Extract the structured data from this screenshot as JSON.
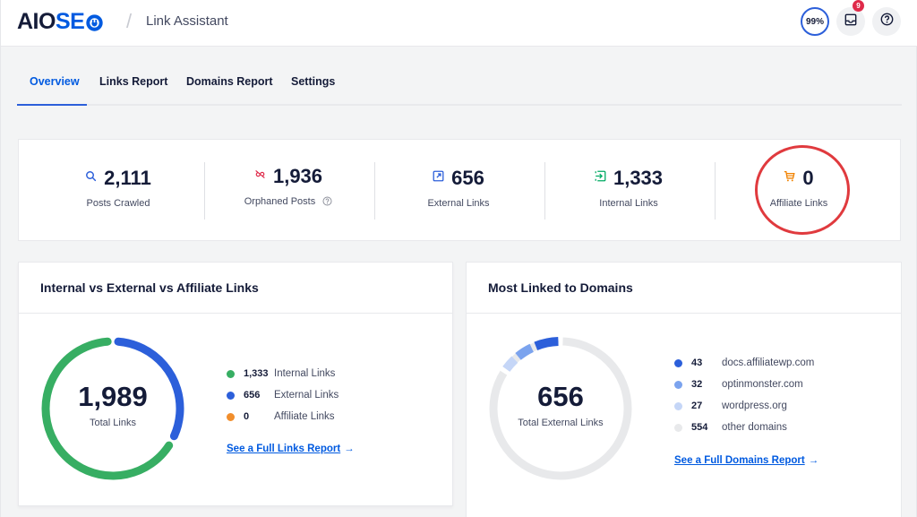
{
  "header": {
    "logo_part1": "AIO",
    "logo_part2": "SE",
    "page_title": "Link Assistant",
    "score": "99%",
    "notifications_count": "9",
    "icons": [
      "logo-gear-icon",
      "inbox-icon",
      "help-icon"
    ]
  },
  "tabs": [
    {
      "label": "Overview",
      "active": true
    },
    {
      "label": "Links Report",
      "active": false
    },
    {
      "label": "Domains Report",
      "active": false
    },
    {
      "label": "Settings",
      "active": false
    }
  ],
  "stats": [
    {
      "value": "2,111",
      "label": "Posts Crawled",
      "icon": "search-icon",
      "color": "#2c5fda"
    },
    {
      "value": "1,936",
      "label": "Orphaned Posts",
      "icon": "unlink-icon",
      "color": "#df2a4a",
      "has_help": true
    },
    {
      "value": "656",
      "label": "External Links",
      "icon": "external-link-icon",
      "color": "#2c5fda"
    },
    {
      "value": "1,333",
      "label": "Internal Links",
      "icon": "internal-link-icon",
      "color": "#00aa63"
    },
    {
      "value": "0",
      "label": "Affiliate Links",
      "icon": "cart-icon",
      "color": "#f18200"
    }
  ],
  "links_panel": {
    "title": "Internal vs External vs Affiliate Links",
    "total": "1,989",
    "total_label": "Total Links",
    "link_text": "See a Full Links Report",
    "arrow": "→"
  },
  "domains_panel": {
    "title": "Most Linked to Domains",
    "total": "656",
    "total_label": "Total External Links",
    "link_text": "See a Full Domains Report",
    "arrow": "→"
  },
  "chart_data": [
    {
      "type": "pie",
      "title": "Internal vs External vs Affiliate Links",
      "categories": [
        "Internal Links",
        "External Links",
        "Affiliate Links"
      ],
      "values": [
        1333,
        656,
        0
      ],
      "display_values": [
        "1,333",
        "656",
        "0"
      ],
      "colors": [
        "#37ae63",
        "#2c5fda",
        "#f18e2c"
      ],
      "total": 1989
    },
    {
      "type": "pie",
      "title": "Most Linked to Domains",
      "categories": [
        "docs.affiliatewp.com",
        "optinmonster.com",
        "wordpress.org",
        "other domains"
      ],
      "values": [
        43,
        32,
        27,
        554
      ],
      "display_values": [
        "43",
        "32",
        "27",
        "554"
      ],
      "colors": [
        "#2c5fda",
        "#7ba3ee",
        "#c5d6f7",
        "#e8e9eb"
      ],
      "total": 656
    }
  ]
}
